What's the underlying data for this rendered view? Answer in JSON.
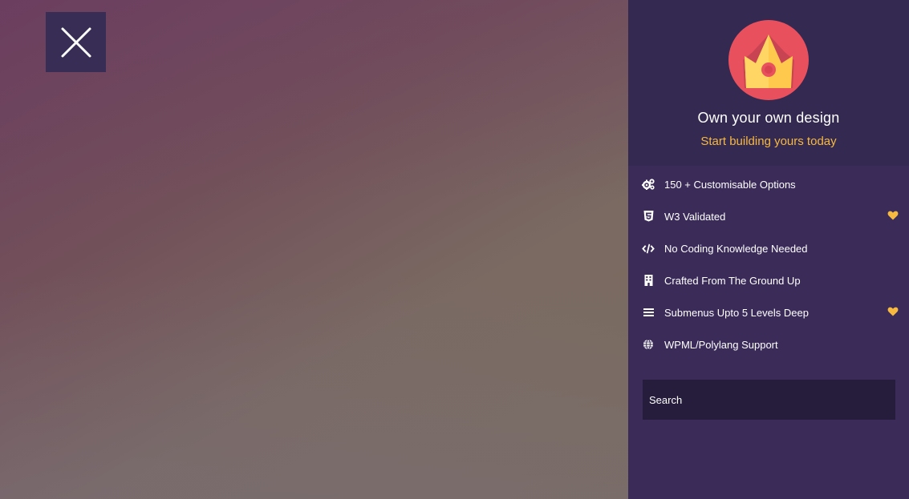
{
  "close_button": {
    "icon": "close-icon"
  },
  "panel": {
    "logo_icon": "crown-icon",
    "title": "Own your own design",
    "subtitle": "Start building yours today",
    "features": [
      {
        "label": "150 + Customisable Options",
        "icon": "gears-icon",
        "favorite": false
      },
      {
        "label": "W3 Validated",
        "icon": "css3-icon",
        "favorite": true
      },
      {
        "label": "No Coding Knowledge Needed",
        "icon": "code-icon",
        "favorite": false
      },
      {
        "label": "Crafted From The Ground Up",
        "icon": "building-icon",
        "favorite": false
      },
      {
        "label": "Submenus Upto 5 Levels Deep",
        "icon": "menu-icon",
        "favorite": true
      },
      {
        "label": "WPML/Polylang Support",
        "icon": "globe-icon",
        "favorite": false
      }
    ],
    "search": {
      "placeholder": "Search",
      "value": ""
    }
  },
  "colors": {
    "panel_bg": "#3a2b59",
    "header_bg": "#342950",
    "accent": "#f7b940",
    "logo_bg": "#e9505e",
    "search_bg": "#261d3c"
  }
}
